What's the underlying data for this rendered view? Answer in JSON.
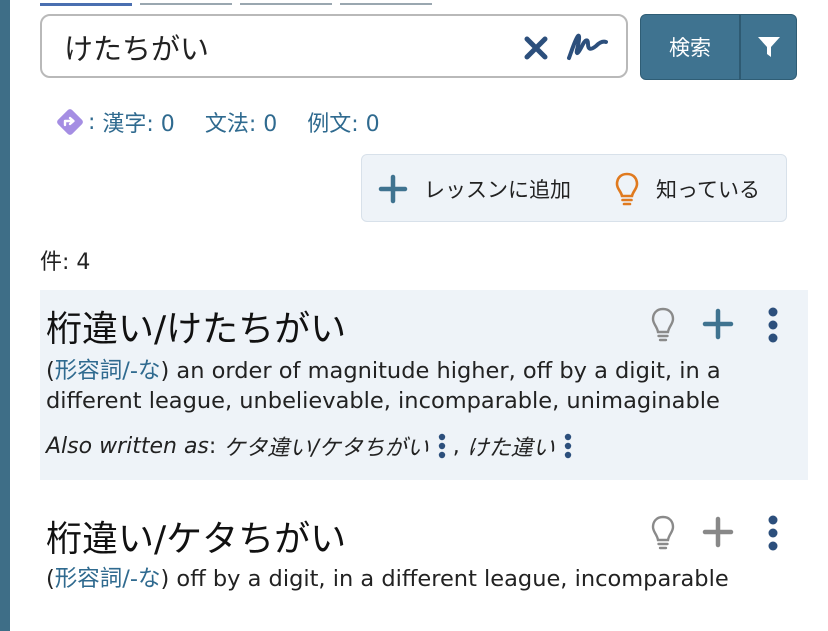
{
  "search": {
    "query": "けたちがい",
    "button_label": "検索"
  },
  "stats": {
    "kanji": "漢字: 0",
    "grammar": "文法: 0",
    "examples": "例文: 0"
  },
  "actions": {
    "add_lesson": "レッスンに追加",
    "known": "知っている"
  },
  "result_count": "件: 4",
  "results": [
    {
      "title": "桁違い/けたちがい",
      "pos": "形容詞/-な",
      "definition": "an order of magnitude higher, off by a digit, in a different league, unbelievable, incomparable, unimaginable",
      "also_label": "Also written as",
      "variants": [
        "ケタ違い/ケタちがい",
        "けた違い"
      ],
      "plus_color": "#3f7390"
    },
    {
      "title": "桁違い/ケタちがい",
      "pos": "形容詞/-な",
      "definition": "off by a digit, in a different league, incomparable",
      "plus_color": "#888888"
    }
  ],
  "colors": {
    "accent": "#3f7390",
    "link": "#2f6a8f",
    "bulb_orange": "#e07a1f",
    "highlight_bg": "#eef3f8"
  }
}
